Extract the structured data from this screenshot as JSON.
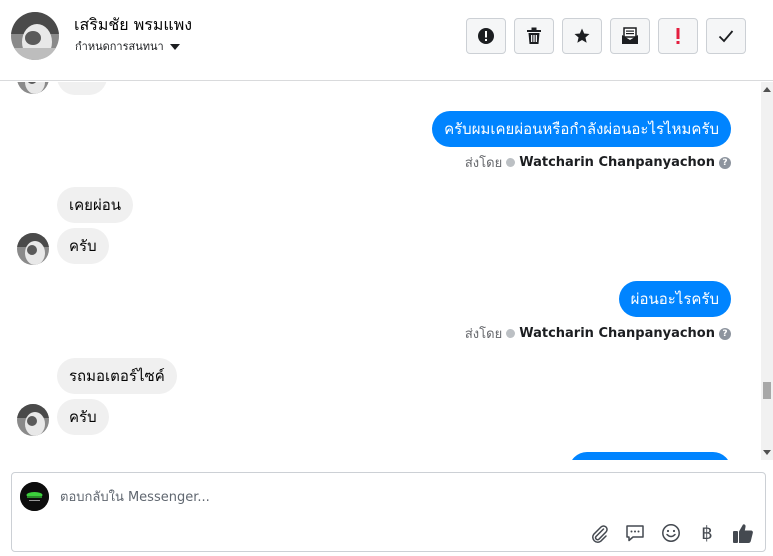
{
  "header": {
    "contact_name": "เสริมชัย พรมแพง",
    "assign_label": "กำหนดการสนทนา",
    "toolbar": [
      "spam-button",
      "delete-button",
      "star-button",
      "mark-unread-button",
      "important-button",
      "done-button"
    ]
  },
  "messages": [
    {
      "direction": "out",
      "text": "ครับผมเคยผ่อนหรือกำลังผ่อนอะไรไหมครับ",
      "sent_by_label": "ส่งโดย",
      "sender": "Watcharin Chanpanyachon"
    },
    {
      "direction": "in",
      "text": "เคยผ่อน"
    },
    {
      "direction": "in",
      "text": "ครับ"
    },
    {
      "direction": "out",
      "text": "ผ่อนอะไรครับ",
      "sent_by_label": "ส่งโดย",
      "sender": "Watcharin Chanpanyachon"
    },
    {
      "direction": "in",
      "text": "รถมอเตอร์ไซค์"
    },
    {
      "direction": "in",
      "text": "ครับ"
    }
  ],
  "composer": {
    "placeholder": "ตอบกลับใน Messenger...",
    "currency_symbol": "฿"
  },
  "colors": {
    "accent": "#0084ff",
    "incoming_bubble": "#f0f0f0"
  }
}
